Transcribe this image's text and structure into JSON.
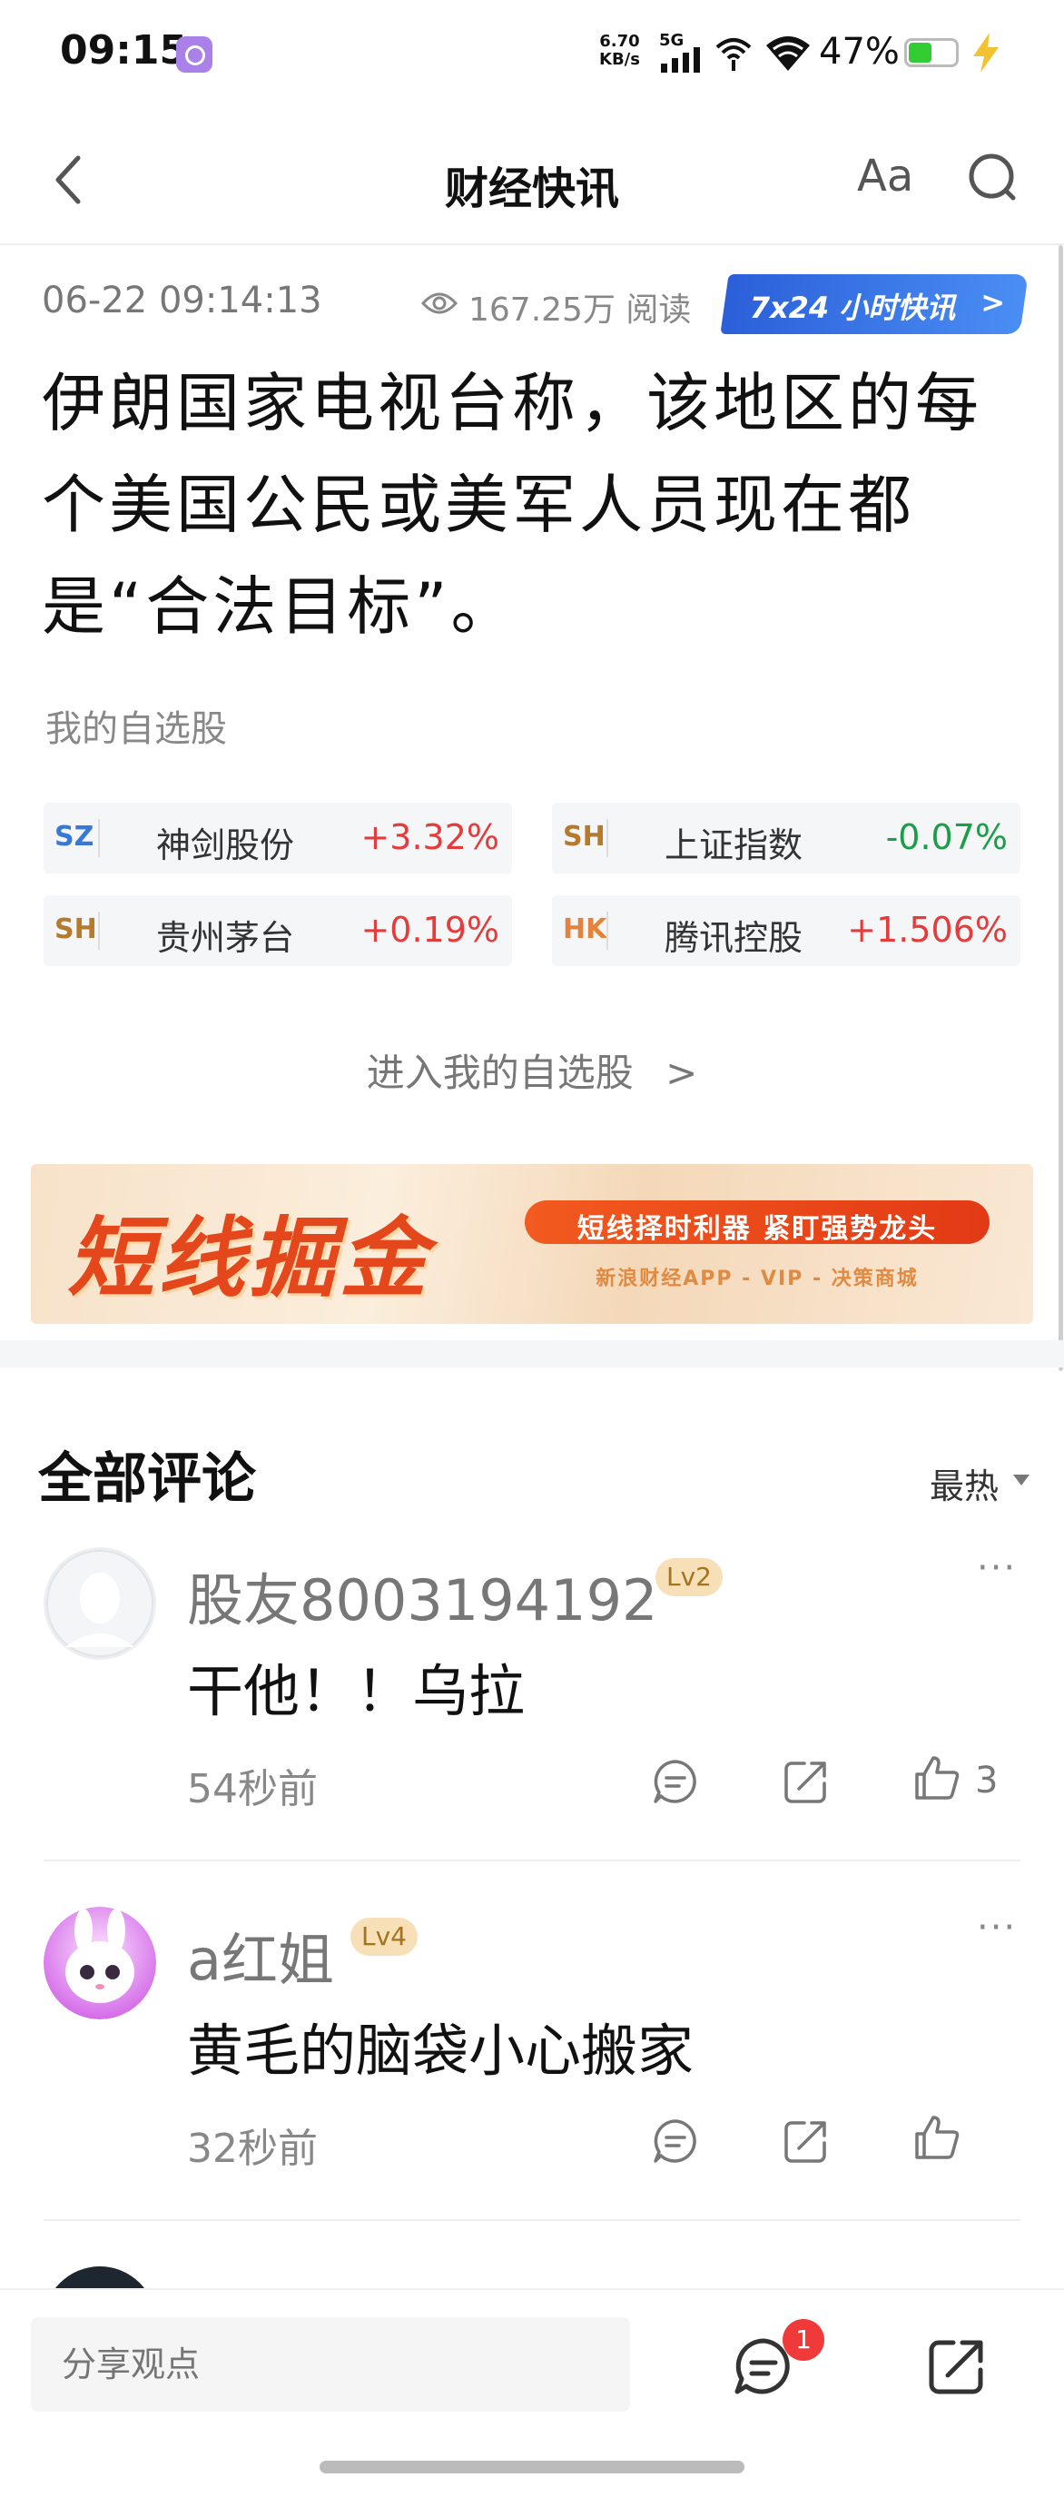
{
  "status_bar": {
    "time": "09:15",
    "net_speed_value": "6.70",
    "net_speed_unit": "KB/s",
    "network": "5G",
    "battery_percent": "47%",
    "battery_level": 0.47,
    "battery_color": "#33cc33"
  },
  "nav": {
    "title": "财经快讯",
    "font_size_label": "Aa",
    "back_icon": "back-chevron-icon",
    "search_icon": "search-icon"
  },
  "article": {
    "datetime": "06-22 09:14:13",
    "read_count": "167.25万 阅读",
    "badge_label": "7x24 小时快讯",
    "badge_chevron": ">",
    "headline": "伊朗国家电视台称，该地区的每个美国公民或美军人员现在都是“合法目标”。"
  },
  "my_stocks": {
    "label": "我的自选股",
    "stocks": [
      {
        "market": "SZ",
        "name": "神剑股份",
        "change": "+3.32%"
      },
      {
        "market": "SH",
        "name": "上证指数",
        "change": "-0.07%"
      },
      {
        "market": "SH",
        "name": "贵州茅台",
        "change": "+0.19%"
      },
      {
        "market": "HK",
        "name": "腾讯控股",
        "change": "+1.506%"
      }
    ],
    "enter_link": "进入我的自选股",
    "enter_chevron": ">"
  },
  "banner": {
    "title": "短线掘金",
    "tagline": "短线择时利器 紧盯强势龙头",
    "subline": "新浪财经APP - VIP - 决策商城"
  },
  "comments": {
    "title": "全部评论",
    "sort": "最热",
    "items": [
      {
        "username": "股友8003194192",
        "level": "Lv2",
        "text": "干他！！乌拉",
        "time": "54秒前",
        "likes": "3",
        "more": "···"
      },
      {
        "username": "a红姐",
        "level": "Lv4",
        "text": "黄毛的脑袋小心搬家",
        "time": "32秒前",
        "likes": "",
        "more": "···"
      }
    ]
  },
  "bottom_bar": {
    "share_placeholder": "分享观点",
    "comment_badge": "1"
  },
  "colors": {
    "up": "#e63b3b",
    "down": "#1a9e48",
    "badge_blue": "#2b5fd9",
    "banner_orange": "#e4471c"
  }
}
